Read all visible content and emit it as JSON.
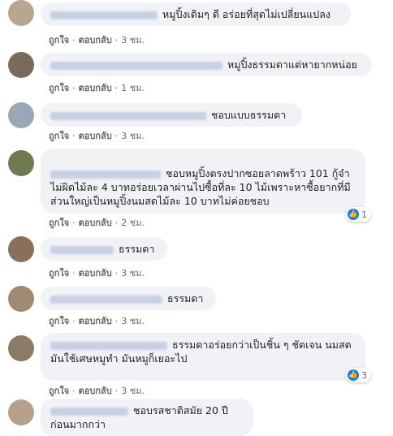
{
  "colors": {
    "bubble": "#f0f2f5",
    "link": "#65676b",
    "like": "#1877f2"
  },
  "actions": {
    "like": "ถูกใจ",
    "reply": "ตอบกลับ",
    "sep": "·"
  },
  "comments": [
    {
      "text": "หมูปิ้งเดิมๆ ดี อร่อยที่สุดไม่เปลี่ยนแปลง",
      "time": "3 ชม.",
      "reactions": ""
    },
    {
      "text": "หมูปิ้งธรรมดาแต่หายากหน่อย",
      "time": "1 ชม.",
      "reactions": ""
    },
    {
      "text": "ชอบแบบธรรมดา",
      "time": "3 ชม.",
      "reactions": ""
    },
    {
      "text": "ชอบหมูปิ้งตรงปากซอยลาดพร้าว 101 กู้จำไม่ผิดไม้ละ 4 บาทอร่อยเวลาผ่านไปซื้อที่ละ 10 ไม้เพราะหาซื้อยากที่มีส่วนใหญ่เป็นหมูปิ้งนมสดไม้ละ 10 บาทไม่ค่อยชอบ",
      "time": "2 ชม.",
      "reactions": "1"
    },
    {
      "text": "ธรรมดา",
      "time": "3 ชม.",
      "reactions": ""
    },
    {
      "text": "ธรรมดา",
      "time": "3 ชม.",
      "reactions": ""
    },
    {
      "text": "ธรรมดาอร่อยกว่าเป็นชิ้น ๆ ชัดเจน นมสดมันใช้เศษหมูทำ มันหมูก็เยอะไป",
      "time": "3 ชม.",
      "reactions": "3"
    },
    {
      "text": "ชอบรสชาติสมัย 20 ปีก่อนมากกว่า",
      "time": "",
      "reactions": ""
    }
  ]
}
